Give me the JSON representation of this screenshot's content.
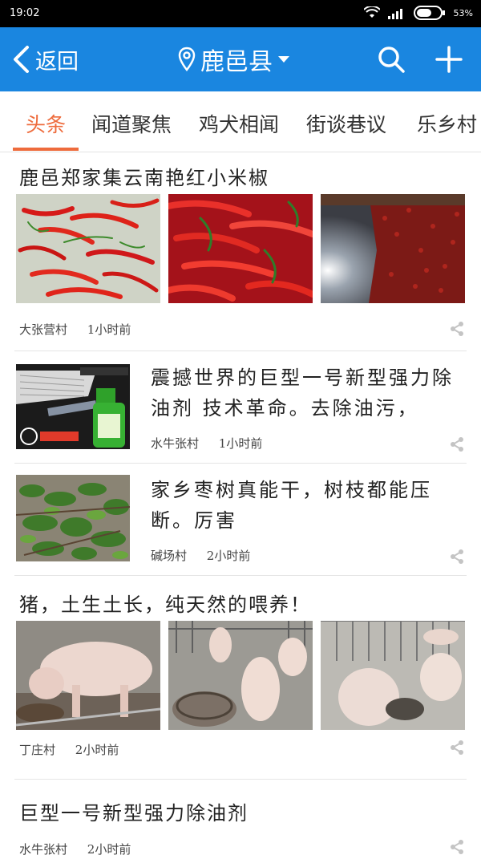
{
  "status_bar": {
    "time": "19:02",
    "battery_percent": "53%",
    "icons": [
      "wifi-icon",
      "signal-icon",
      "battery-icon"
    ]
  },
  "app_bar": {
    "back_label": "返回",
    "location": "鹿邑县",
    "icons": [
      "chevron-left-icon",
      "location-pin-icon",
      "dropdown-caret-icon",
      "search-icon",
      "plus-icon"
    ],
    "background_color": "#1a86e0"
  },
  "tabs": {
    "items": [
      {
        "label": "头条",
        "active": true
      },
      {
        "label": "闻道聚焦",
        "active": false
      },
      {
        "label": "鸡犬相闻",
        "active": false
      },
      {
        "label": "街谈巷议",
        "active": false
      },
      {
        "label": "乐乡村",
        "active": false
      }
    ],
    "accent_color": "#ee6b3c"
  },
  "feed": {
    "items": [
      {
        "title": "鹿邑郑家集云南艳红小米椒",
        "village": "大张营村",
        "time": "1小时前",
        "images": [
          "red-chili-pile-photo",
          "red-chili-closeup-photo",
          "chili-drying-room-photo"
        ]
      },
      {
        "title": "震撼世界的巨型一号新型强力除油剂 技术革命。去除油污，",
        "village": "水牛张村",
        "time": "1小时前",
        "images": [
          "degreaser-spray-bottle-photo"
        ]
      },
      {
        "title": "家乡枣树真能干，树枝都能压断。厉害",
        "village": "碱场村",
        "time": "2小时前",
        "images": [
          "jujube-branches-photo"
        ]
      },
      {
        "title": "猪，土生土长，纯天然的喂养！",
        "village": "丁庄村",
        "time": "2小时前",
        "images": [
          "pig-eating-photo",
          "pigs-pen-feeder-photo",
          "pigs-sleeping-photo"
        ]
      },
      {
        "title": "巨型一号新型强力除油剂",
        "village": "水牛张村",
        "time": "2小时前",
        "images": []
      }
    ],
    "share_icon": "share-icon"
  }
}
